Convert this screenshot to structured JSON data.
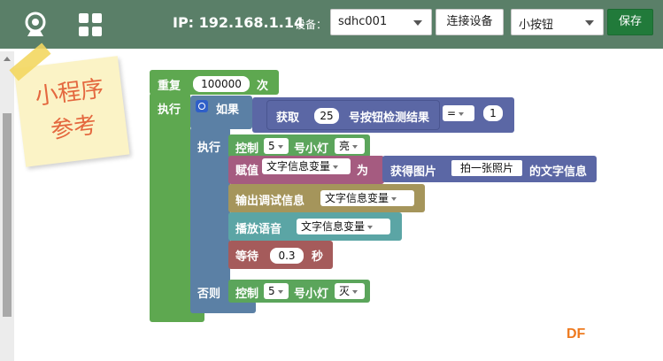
{
  "topbar": {
    "ip_text": "IP: 192.168.1.14",
    "device_label": "设备：",
    "device_select": "sdhc001",
    "connect_button": "连接设备",
    "mode_select": "小按钮",
    "save_button": "保存",
    "icons": [
      "camera-icon",
      "grid-icon"
    ]
  },
  "note": {
    "line1": "小程序",
    "line2": "参考"
  },
  "blocks": {
    "repeat": {
      "label": "重复",
      "count": "100000",
      "times": "次"
    },
    "repeat_do": "执行",
    "if": {
      "label": "如果"
    },
    "get_button": {
      "label": "获取",
      "number": "25",
      "suffix": "号按钮检测结果"
    },
    "compare": {
      "op": "=",
      "value": "1"
    },
    "if_do": "执行",
    "light1": {
      "label": "控制",
      "number": "5",
      "suffix": "号小灯",
      "state": "亮"
    },
    "assign": {
      "label": "赋值",
      "var": "文字信息变量",
      "as": "为"
    },
    "get_image": {
      "label": "获得图片",
      "source": "拍一张照片",
      "suffix": "的文字信息"
    },
    "debug": {
      "label": "输出调试信息",
      "var": "文字信息变量"
    },
    "speak": {
      "label": "播放语音",
      "var": "文字信息变量"
    },
    "wait": {
      "label": "等待",
      "value": "0.3",
      "unit": "秒"
    },
    "else_label": "否则",
    "light2": {
      "label": "控制",
      "number": "5",
      "suffix": "号小灯",
      "state": "灭"
    }
  },
  "watermark": "DF",
  "colors": {
    "topbar": "#5a7f68",
    "loop_green": "#5ea850",
    "logic_blue": "#5b80a5",
    "sensor_purple": "#5b67a5",
    "hardware_green": "#5ba55b",
    "variable_pink": "#a55b80",
    "debug_olive": "#a5955b",
    "speak_teal": "#5ba5a5",
    "wait_red": "#a55b5b",
    "save_green": "#217a3a"
  }
}
